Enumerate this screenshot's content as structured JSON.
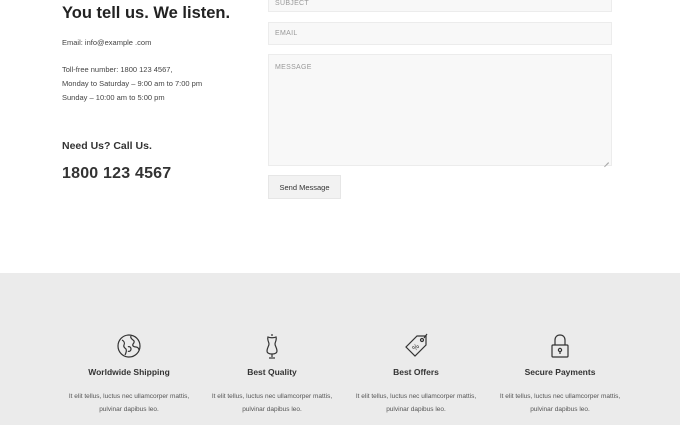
{
  "contact": {
    "headline": "You tell us. We listen.",
    "email_line": "Email: info@example .com",
    "tollfree_line": "Toll-free number: 1800 123 4567,",
    "weekday_hours": "Monday to Saturday – 9:00 am to 7:00 pm",
    "sunday_hours": "Sunday – 10:00 am to 5:00 pm",
    "need_us": "Need Us? Call Us.",
    "phone": "1800 123 4567"
  },
  "form": {
    "subject_placeholder": "SUBJECT",
    "email_placeholder": "EMAIL",
    "message_placeholder": "MESSAGE",
    "send_label": "Send Message"
  },
  "features": [
    {
      "icon": "globe-icon",
      "title": "Worldwide Shipping",
      "desc": "It elit tellus, luctus nec ullamcorper mattis, pulvinar dapibus leo."
    },
    {
      "icon": "dress-form-icon",
      "title": "Best Quality",
      "desc": "It elit tellus, luctus nec ullamcorper mattis, pulvinar dapibus leo."
    },
    {
      "icon": "price-tag-icon",
      "title": "Best Offers",
      "desc": "It elit tellus, luctus nec ullamcorper mattis, pulvinar dapibus leo."
    },
    {
      "icon": "lock-icon",
      "title": "Secure Payments",
      "desc": "It elit tellus, luctus nec ullamcorper mattis, pulvinar dapibus leo."
    }
  ]
}
